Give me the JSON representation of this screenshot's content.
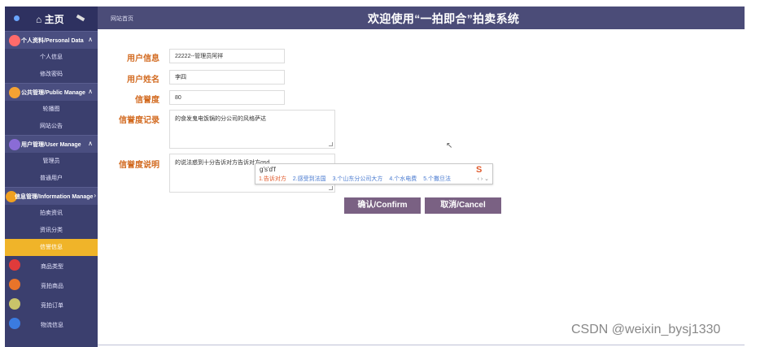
{
  "sidebar": {
    "home_label": "主页",
    "groups": [
      {
        "label": "个人资料/Personal Data",
        "color": "#ff6b6b",
        "items": [
          "个人信息",
          "修改密码"
        ]
      },
      {
        "label": "公共管理/Public Manage",
        "color": "#f4a233",
        "items": [
          "轮播图",
          "网站公告"
        ]
      },
      {
        "label": "用户管理/User Manage",
        "color": "#8a6cd6",
        "items": [
          "管理员",
          "普通用户"
        ]
      },
      {
        "label": "信息管理/Information Manage",
        "color": "#f0a020",
        "items": [
          "拍卖资讯",
          "资讯分类",
          "信誉信息"
        ]
      }
    ],
    "extra_items": [
      "商品类型",
      "竞拍商品",
      "竞拍订单",
      "物流信息"
    ],
    "active_item": "信誉信息",
    "active_color": "#f0b429"
  },
  "header": {
    "breadcrumb": "网站首页",
    "title": "欢迎使用“一拍即合”拍卖系统"
  },
  "form": {
    "user_info_label": "用户信息",
    "user_info_value": "22222--管理员阿祥",
    "user_name_label": "用户姓名",
    "user_name_value": "李四",
    "credit_label": "信誉度",
    "credit_value": "80",
    "credit_record_label": "信誉度记录",
    "credit_record_value": "的食发鬼电饭锅的分公司的风格萨达",
    "credit_desc_label": "信誉度说明",
    "credit_desc_value": "的说法惑到十分告诉对方告诉对方gsd"
  },
  "ime": {
    "input": "g's'd'f",
    "candidates": [
      "1.告诉对方",
      "2.感受到法国",
      "3.个山东分公司大方",
      "4.个水电费",
      "5.个撒旦法"
    ],
    "logo": "S",
    "nav": "‹ › ⌄"
  },
  "buttons": {
    "confirm": "确认/Confirm",
    "cancel": "取消/Cancel"
  },
  "watermark": "CSDN @weixin_bysj1330"
}
